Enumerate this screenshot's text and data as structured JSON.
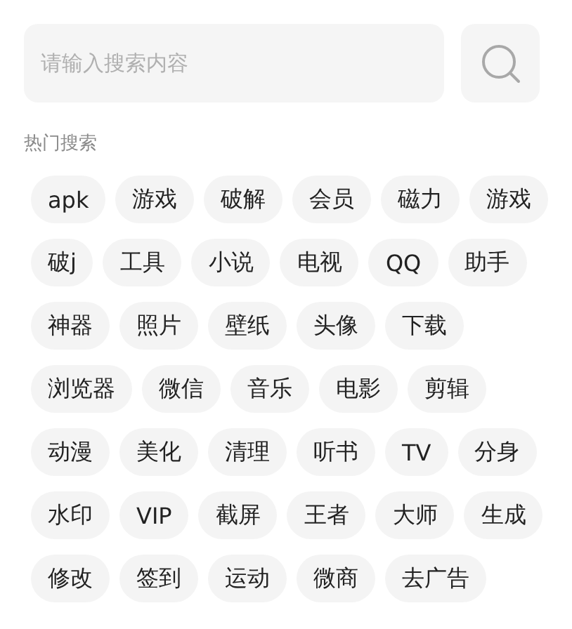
{
  "search": {
    "placeholder": "请输入搜索内容"
  },
  "hot_title": "热门搜索",
  "tag_rows": [
    [
      "apk",
      "游戏",
      "破解",
      "会员",
      "磁力",
      "游戏"
    ],
    [
      "破j",
      "工具",
      "小说",
      "电视",
      "QQ",
      "助手"
    ],
    [
      "神器",
      "照片",
      "壁纸",
      "头像",
      "下载"
    ],
    [
      "浏览器",
      "微信",
      "音乐",
      "电影",
      "剪辑"
    ],
    [
      "动漫",
      "美化",
      "清理",
      "听书",
      "TV",
      "分身"
    ],
    [
      "水印",
      "VIP",
      "截屏",
      "王者",
      "大师",
      "生成"
    ],
    [
      "修改",
      "签到",
      "运动",
      "微商",
      "去广告"
    ]
  ]
}
